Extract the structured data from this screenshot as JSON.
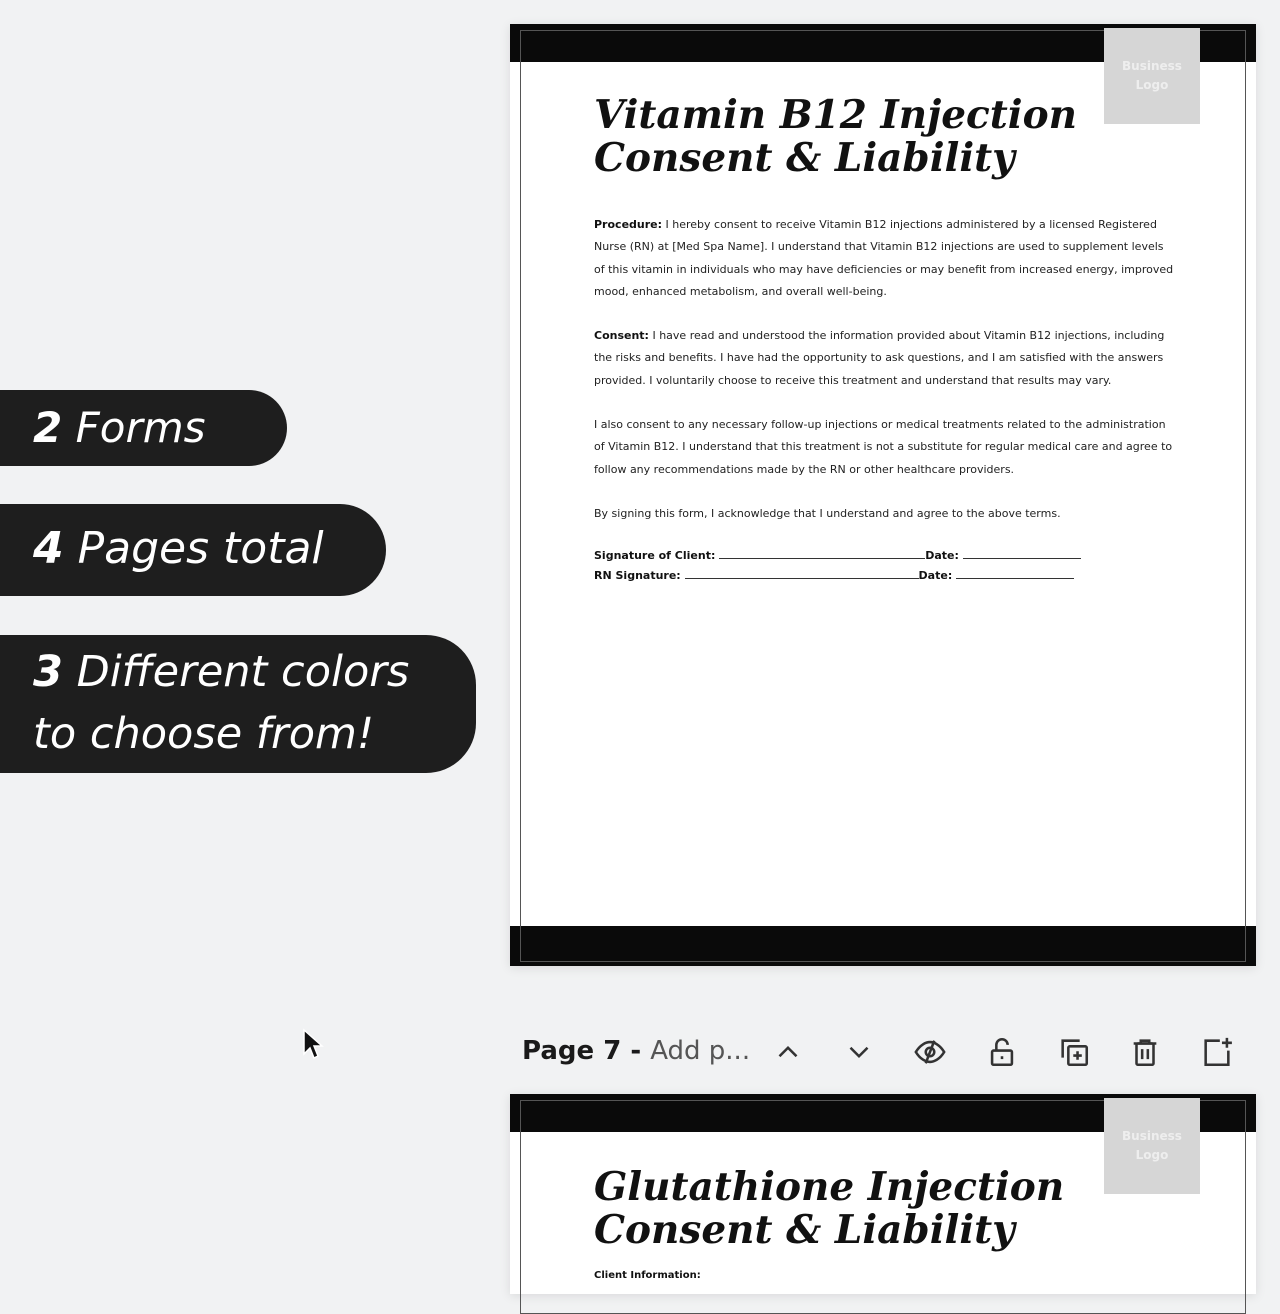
{
  "features": {
    "forms": {
      "num": "2",
      "text": " Forms"
    },
    "pages": {
      "num": "4",
      "text": " Pages total"
    },
    "colors": {
      "num": "3",
      "line1": " Different colors",
      "line2": "to choose from!"
    }
  },
  "page1": {
    "logo": "Business\nLogo",
    "title": "Vitamin B12 Injection\nConsent & Liability",
    "procedure_label": "Procedure:",
    "procedure_text": " I hereby consent to receive Vitamin B12 injections administered by a licensed Registered Nurse (RN) at [Med Spa Name]. I understand that Vitamin B12 injections are used to supplement levels of this vitamin in individuals who may have deficiencies or may benefit from increased energy, improved mood, enhanced metabolism, and overall well-being.",
    "consent_label": "Consent:",
    "consent_text": " I have read and understood the information provided about Vitamin B12 injections, including the risks and benefits. I have had the opportunity to ask questions, and I am satisfied with the answers provided. I voluntarily choose to receive this treatment and understand that results may vary.",
    "followup_text": "I also consent to any necessary follow-up injections or medical treatments related to the administration of Vitamin B12. I understand that this treatment is not a substitute for regular medical care and agree to follow any recommendations made by the RN or other healthcare providers.",
    "ack_text": "By signing this form, I acknowledge that I understand and agree to the above terms.",
    "sig_client_label": "Signature of Client:",
    "sig_rn_label": "RN Signature:",
    "date_label": "Date:"
  },
  "toolbar": {
    "page_label": "Page 7 - ",
    "add_title": "Add p...",
    "icons": [
      "chevron-up-icon",
      "chevron-down-icon",
      "hide-eye-icon",
      "unlock-icon",
      "duplicate-icon",
      "trash-icon",
      "add-page-icon"
    ]
  },
  "page2": {
    "logo": "Business\nLogo",
    "title": "Glutathione Injection\nConsent & Liability",
    "client_info_label": "Client Information:"
  }
}
